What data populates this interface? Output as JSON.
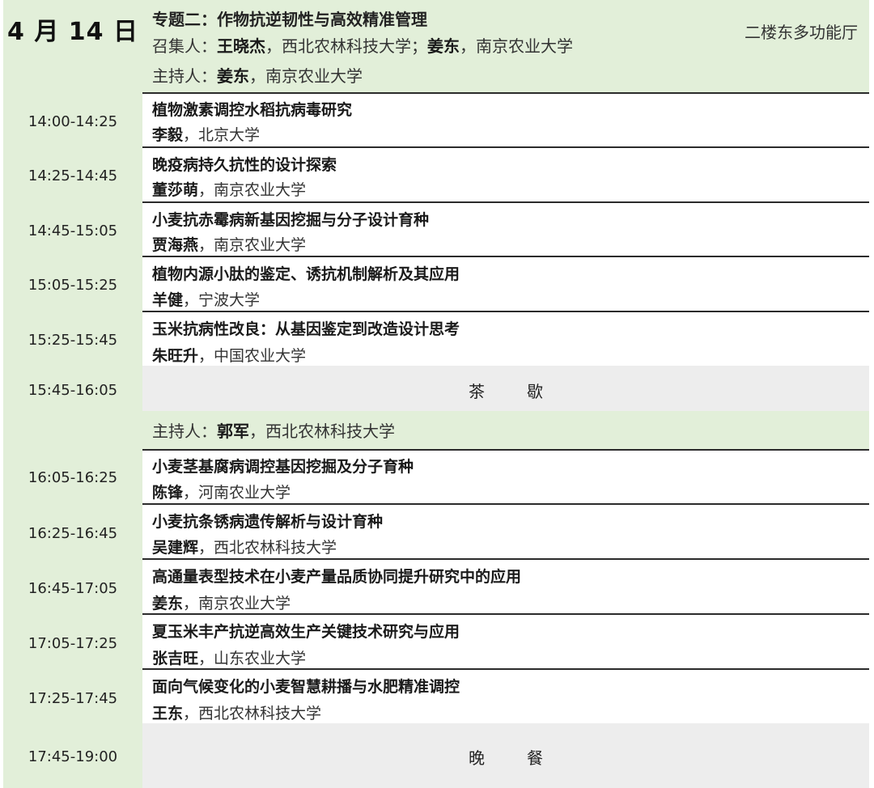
{
  "header": {
    "date": "4 月 14 日",
    "topic": "专题二：作物抗逆韧性与高效精准管理",
    "conveners_label": "召集人：",
    "convener1_name": "王晓杰",
    "convener1_org": "，西北农林科技大学；",
    "convener2_name": "姜东",
    "convener2_org": "，南京农业大学",
    "room": "二楼东多功能厅"
  },
  "host1": {
    "label": "主持人：",
    "name": "姜东",
    "org": "，南京农业大学"
  },
  "host2": {
    "label": "主持人：",
    "name": "郭军",
    "org": "，西北农林科技大学"
  },
  "talks": [
    {
      "time": "14:00-14:25",
      "title": "植物激素调控水稻抗病毒研究",
      "speaker": "李毅",
      "org": "，北京大学"
    },
    {
      "time": "14:25-14:45",
      "title": "晚疫病持久抗性的设计探索",
      "speaker": "董莎萌",
      "org": "，南京农业大学"
    },
    {
      "time": "14:45-15:05",
      "title": "小麦抗赤霉病新基因挖掘与分子设计育种",
      "speaker": "贾海燕",
      "org": "，南京农业大学"
    },
    {
      "time": "15:05-15:25",
      "title": "植物内源小肽的鉴定、诱抗机制解析及其应用",
      "speaker": "羊健",
      "org": "，宁波大学"
    },
    {
      "time": "15:25-15:45",
      "title": "玉米抗病性改良：从基因鉴定到改造设计思考",
      "speaker": "朱旺升",
      "org": "，中国农业大学"
    },
    {
      "time": "16:05-16:25",
      "title": "小麦茎基腐病调控基因挖掘及分子育种",
      "speaker": "陈锋",
      "org": "，河南农业大学"
    },
    {
      "time": "16:25-16:45",
      "title": "小麦抗条锈病遗传解析与设计育种",
      "speaker": "吴建辉",
      "org": "，西北农林科技大学"
    },
    {
      "time": "16:45-17:05",
      "title": "高通量表型技术在小麦产量品质协同提升研究中的应用",
      "speaker": "姜东",
      "org": "，南京农业大学"
    },
    {
      "time": "17:05-17:25",
      "title": "夏玉米丰产抗逆高效生产关键技术研究与应用",
      "speaker": "张吉旺",
      "org": "，山东农业大学"
    },
    {
      "time": "17:25-17:45",
      "title": "面向气候变化的小麦智慧耕播与水肥精准调控",
      "speaker": "王东",
      "org": "，西北农林科技大学"
    }
  ],
  "breaks": [
    {
      "time": "15:45-16:05",
      "label": "茶歇"
    },
    {
      "time": "17:45-19:00",
      "label": "晚餐"
    }
  ]
}
